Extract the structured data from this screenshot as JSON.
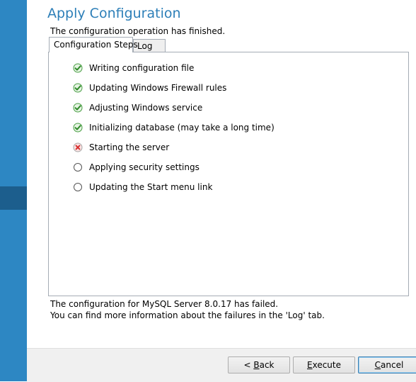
{
  "header": {
    "title": "Apply Configuration",
    "subtitle": "The configuration operation has finished."
  },
  "tabs": [
    {
      "label": "Configuration Steps",
      "active": true
    },
    {
      "label": "Log",
      "active": false
    }
  ],
  "steps": [
    {
      "label": "Writing configuration file",
      "status": "success",
      "icon": "check-icon"
    },
    {
      "label": "Updating Windows Firewall rules",
      "status": "success",
      "icon": "check-icon"
    },
    {
      "label": "Adjusting Windows service",
      "status": "success",
      "icon": "check-icon"
    },
    {
      "label": "Initializing database (may take a long time)",
      "status": "success",
      "icon": "check-icon"
    },
    {
      "label": "Starting the server",
      "status": "failed",
      "icon": "error-icon"
    },
    {
      "label": "Applying security settings",
      "status": "pending",
      "icon": "pending-circle-icon"
    },
    {
      "label": "Updating the Start menu link",
      "status": "pending",
      "icon": "pending-circle-icon"
    }
  ],
  "footer": {
    "line1": "The configuration for MySQL Server 8.0.17 has failed.",
    "line2": "You can find more information about the failures in the 'Log' tab."
  },
  "buttons": {
    "back_prefix": "< ",
    "back_mnemonic": "B",
    "back_rest": "ack",
    "execute_mnemonic": "E",
    "execute_rest": "xecute",
    "cancel_mnemonic": "C",
    "cancel_rest": "ancel"
  },
  "colors": {
    "accent": "#2d7fb8",
    "sidebar": "#2d87c3",
    "sidebar_selected": "#1c5e8d",
    "success": "#3aa335",
    "error": "#d62d2d"
  }
}
